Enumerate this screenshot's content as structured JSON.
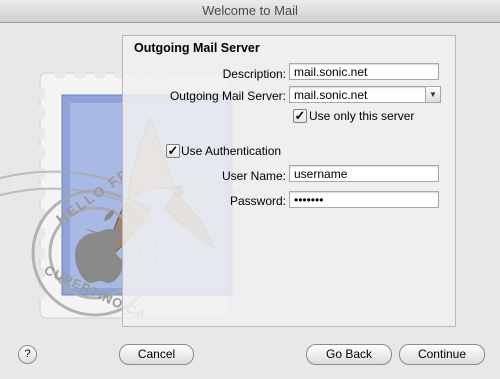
{
  "window": {
    "title": "Welcome to Mail"
  },
  "art": {
    "stamp_text_top": "HELLO FR",
    "stamp_text_bottom": "CUPERTINO CA"
  },
  "form": {
    "heading": "Outgoing Mail Server",
    "description_label": "Description:",
    "description_value": "mail.sonic.net",
    "server_label": "Outgoing Mail Server:",
    "server_value": "mail.sonic.net",
    "use_only_server_label": "Use only this server",
    "use_only_server_checked": true,
    "use_auth_label": "Use Authentication",
    "use_auth_checked": true,
    "username_label": "User Name:",
    "username_value": "username",
    "password_label": "Password:",
    "password_value": "•••••••"
  },
  "buttons": {
    "help": "?",
    "cancel": "Cancel",
    "go_back": "Go Back",
    "continue": "Continue"
  }
}
